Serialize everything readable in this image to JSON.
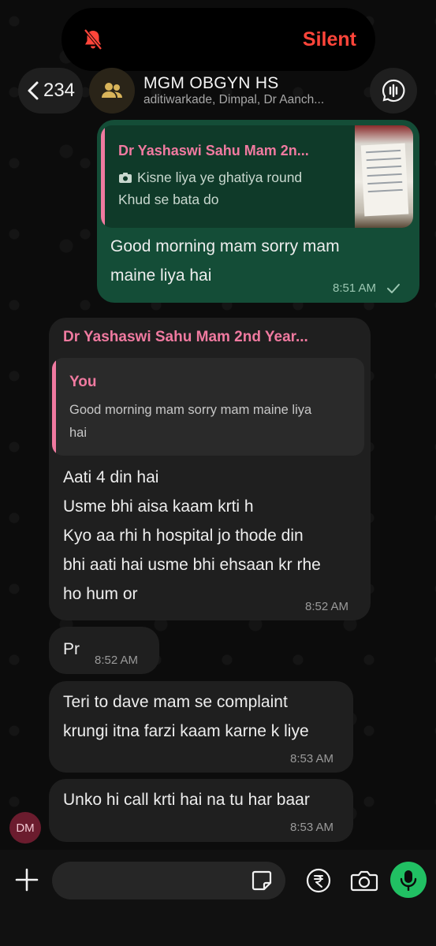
{
  "status": {
    "mode_label": "Silent",
    "icon": "bell-slash-icon"
  },
  "header": {
    "back_count": "234",
    "title": "MGM OBGYN HS",
    "members": "aditiwarkade, Dimpal, Dr Aanch...",
    "avatar_icon": "group-icon",
    "voice_icon": "voice-chat-icon"
  },
  "messages": [
    {
      "direction": "outgoing",
      "quote": {
        "sender": "Dr Yashaswi Sahu  Mam 2n...",
        "line1": "Kisne liya ye ghatiya round",
        "line2": "Khud se bata do",
        "has_photo": true
      },
      "lines": [
        "Good morning mam sorry mam",
        "maine liya hai"
      ],
      "time": "8:51 AM",
      "status": "sent"
    },
    {
      "direction": "incoming",
      "sender": "Dr Yashaswi Sahu  Mam 2nd Year...",
      "quote": {
        "sender": "You",
        "text_lines": [
          "Good morning mam sorry mam maine liya",
          "hai"
        ]
      },
      "lines": [
        "Aati 4 din hai",
        "Usme bhi aisa kaam krti h",
        "Kyo aa rhi h hospital jo thode din",
        "bhi aati hai usme bhi ehsaan kr rhe",
        "ho hum or"
      ],
      "time": "8:52 AM"
    },
    {
      "direction": "incoming",
      "lines": [
        "Pr"
      ],
      "time": "8:52 AM"
    },
    {
      "direction": "incoming",
      "lines": [
        "Teri to dave mam se complaint",
        "krungi itna farzi kaam karne k liye"
      ],
      "time": "8:53 AM"
    },
    {
      "direction": "incoming",
      "lines": [
        "Unko hi call krti hai na tu har baar"
      ],
      "time": "8:53 AM",
      "avatar_initials": "DM"
    }
  ],
  "input": {
    "placeholder": "",
    "icons": [
      "plus-icon",
      "sticker-icon",
      "rupee-icon",
      "camera-icon",
      "mic-icon"
    ]
  },
  "colors": {
    "outgoing_bubble": "#144d37",
    "incoming_bubble": "#1f1f1f",
    "sender_name": "#f07aa0",
    "silent": "#ff453a",
    "mic": "#21c063"
  }
}
